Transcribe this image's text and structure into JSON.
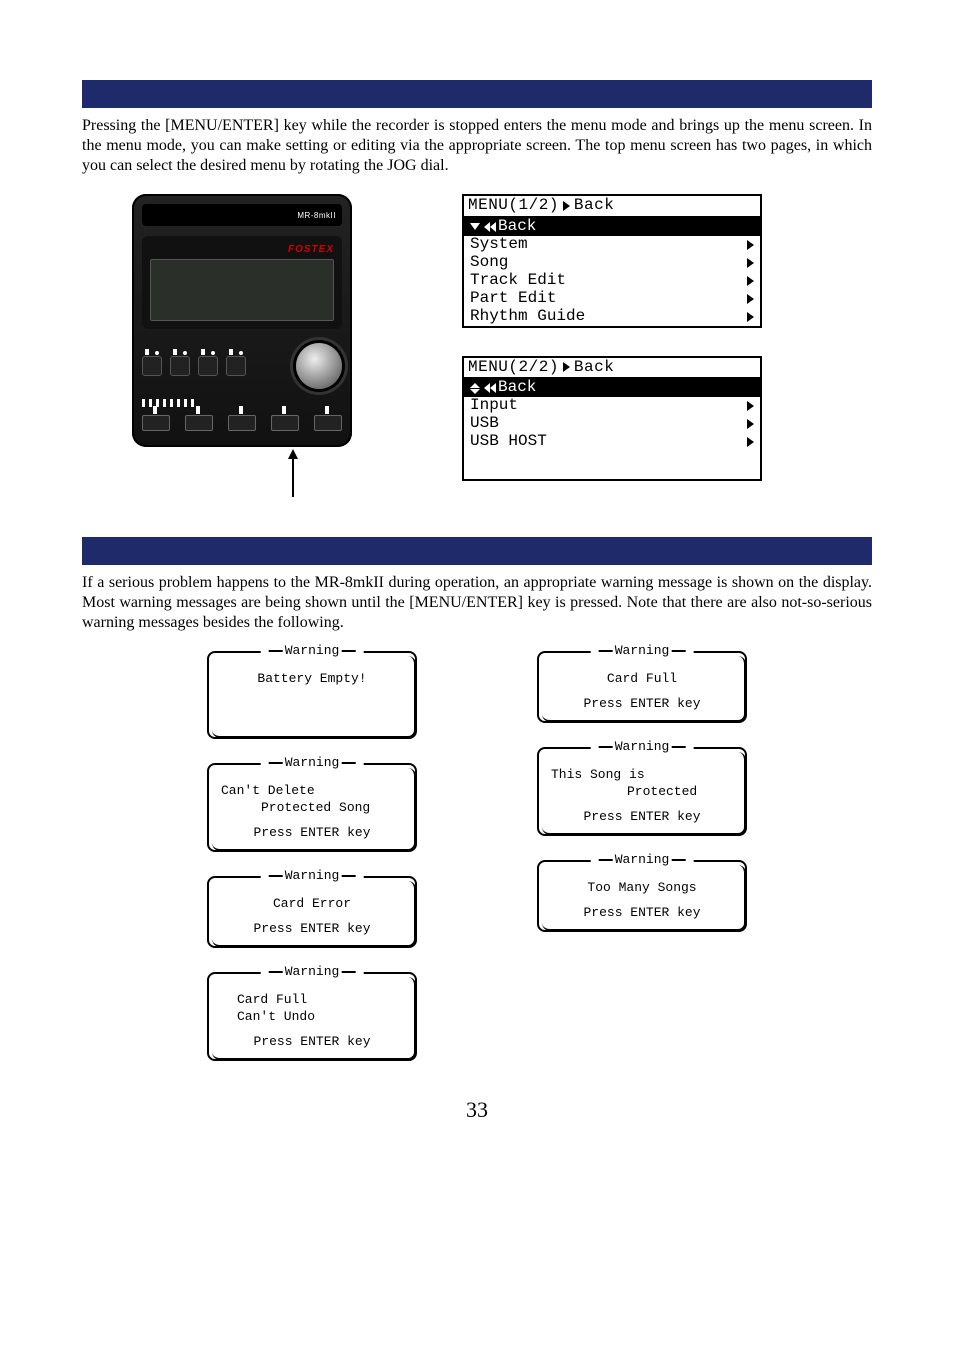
{
  "device_label": "MR-8mkII",
  "brand": "FOSTEX",
  "section1_text": "Pressing the [MENU/ENTER] key while the recorder is stopped enters the menu mode and brings up the menu screen.  In the menu mode, you can make setting or editing via the appropriate screen. The top menu screen has two pages, in which you can select the desired menu by rotating the JOG dial.",
  "menu1": {
    "title_left": "MENU(1/2)",
    "title_right": "Back",
    "items": [
      "Back",
      "System",
      "Song",
      "Track Edit",
      "Part Edit",
      "Rhythm Guide"
    ]
  },
  "menu2": {
    "title_left": "MENU(2/2)",
    "title_right": "Back",
    "items": [
      "Back",
      "Input",
      "USB",
      "USB HOST"
    ]
  },
  "section2_text": "If a serious problem happens to the MR-8mkII during operation, an appropriate warning message is shown on the display. Most warning messages are being shown until the [MENU/ENTER] key is pressed. Note that there are also not-so-serious warning messages besides the following.",
  "warning_label": "Warning",
  "press_enter": "Press ENTER key",
  "warnings_left": [
    {
      "l1": "Battery Empty!",
      "l2": "",
      "press": false,
      "style": "center"
    },
    {
      "l1": "Can't Delete",
      "l2": "Protected Song",
      "press": true,
      "style": "leftright"
    },
    {
      "l1": "Card Error",
      "l2": "",
      "press": true,
      "style": "center"
    },
    {
      "l1": "Card Full",
      "l2": "Can't Undo",
      "press": true,
      "style": "leftleft"
    }
  ],
  "warnings_right": [
    {
      "l1": "Card Full",
      "l2": "",
      "press": true,
      "style": "center"
    },
    {
      "l1": "This Song is",
      "l2": "Protected",
      "press": true,
      "style": "leftright"
    },
    {
      "l1": "Too Many Songs",
      "l2": "",
      "press": true,
      "style": "center"
    }
  ],
  "page_number": "33"
}
